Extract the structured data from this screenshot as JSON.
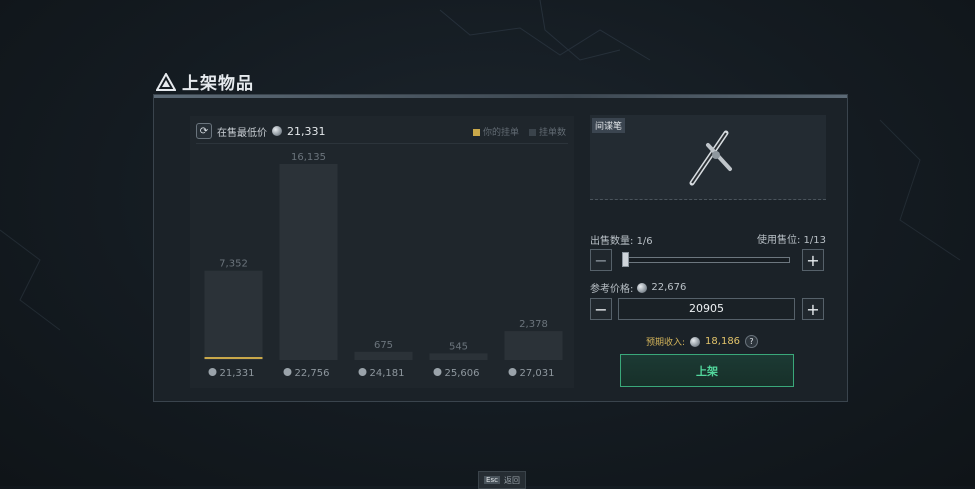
{
  "title": "上架物品",
  "lowest_price": {
    "label": "在售最低价",
    "value": "21,331"
  },
  "legend": {
    "mine": "你的挂单",
    "total": "挂单数",
    "mine_color": "#c9a84a",
    "total_color": "#3a434b"
  },
  "chart_data": {
    "type": "bar",
    "categories": [
      "21,331",
      "22,756",
      "24,181",
      "25,606",
      "27,031"
    ],
    "values": [
      7352,
      16135,
      675,
      545,
      2378
    ],
    "value_labels": [
      "7,352",
      "16,135",
      "675",
      "545",
      "2,378"
    ],
    "highlight_index": 0,
    "highlight_color": "#c9a84a",
    "bar_color": "#2b3238",
    "ylim": [
      0,
      16135
    ]
  },
  "item": {
    "name": "间谍笔",
    "icon": "spy-pen-icon"
  },
  "quantity": {
    "label": "出售数量:",
    "value": "1/6",
    "slot_label": "使用售位:",
    "slot_value": "1/13",
    "level": 0.0
  },
  "reference_price": {
    "label": "参考价格:",
    "value": "22,676"
  },
  "price_input": {
    "value": "20905"
  },
  "income": {
    "label": "预期收入:",
    "value": "18,186",
    "help": "?"
  },
  "list_button": {
    "label": "上架"
  },
  "escape": {
    "key": "Esc",
    "label": "返回"
  }
}
